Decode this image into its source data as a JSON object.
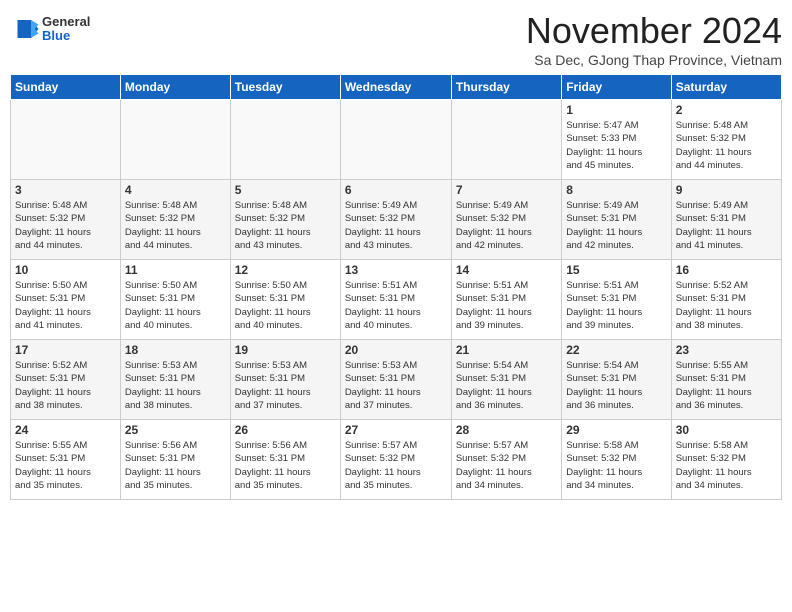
{
  "logo": {
    "general": "General",
    "blue": "Blue"
  },
  "title": "November 2024",
  "location": "Sa Dec, GJong Thap Province, Vietnam",
  "days_of_week": [
    "Sunday",
    "Monday",
    "Tuesday",
    "Wednesday",
    "Thursday",
    "Friday",
    "Saturday"
  ],
  "weeks": [
    [
      {
        "day": "",
        "info": ""
      },
      {
        "day": "",
        "info": ""
      },
      {
        "day": "",
        "info": ""
      },
      {
        "day": "",
        "info": ""
      },
      {
        "day": "",
        "info": ""
      },
      {
        "day": "1",
        "info": "Sunrise: 5:47 AM\nSunset: 5:33 PM\nDaylight: 11 hours\nand 45 minutes."
      },
      {
        "day": "2",
        "info": "Sunrise: 5:48 AM\nSunset: 5:32 PM\nDaylight: 11 hours\nand 44 minutes."
      }
    ],
    [
      {
        "day": "3",
        "info": "Sunrise: 5:48 AM\nSunset: 5:32 PM\nDaylight: 11 hours\nand 44 minutes."
      },
      {
        "day": "4",
        "info": "Sunrise: 5:48 AM\nSunset: 5:32 PM\nDaylight: 11 hours\nand 44 minutes."
      },
      {
        "day": "5",
        "info": "Sunrise: 5:48 AM\nSunset: 5:32 PM\nDaylight: 11 hours\nand 43 minutes."
      },
      {
        "day": "6",
        "info": "Sunrise: 5:49 AM\nSunset: 5:32 PM\nDaylight: 11 hours\nand 43 minutes."
      },
      {
        "day": "7",
        "info": "Sunrise: 5:49 AM\nSunset: 5:32 PM\nDaylight: 11 hours\nand 42 minutes."
      },
      {
        "day": "8",
        "info": "Sunrise: 5:49 AM\nSunset: 5:31 PM\nDaylight: 11 hours\nand 42 minutes."
      },
      {
        "day": "9",
        "info": "Sunrise: 5:49 AM\nSunset: 5:31 PM\nDaylight: 11 hours\nand 41 minutes."
      }
    ],
    [
      {
        "day": "10",
        "info": "Sunrise: 5:50 AM\nSunset: 5:31 PM\nDaylight: 11 hours\nand 41 minutes."
      },
      {
        "day": "11",
        "info": "Sunrise: 5:50 AM\nSunset: 5:31 PM\nDaylight: 11 hours\nand 40 minutes."
      },
      {
        "day": "12",
        "info": "Sunrise: 5:50 AM\nSunset: 5:31 PM\nDaylight: 11 hours\nand 40 minutes."
      },
      {
        "day": "13",
        "info": "Sunrise: 5:51 AM\nSunset: 5:31 PM\nDaylight: 11 hours\nand 40 minutes."
      },
      {
        "day": "14",
        "info": "Sunrise: 5:51 AM\nSunset: 5:31 PM\nDaylight: 11 hours\nand 39 minutes."
      },
      {
        "day": "15",
        "info": "Sunrise: 5:51 AM\nSunset: 5:31 PM\nDaylight: 11 hours\nand 39 minutes."
      },
      {
        "day": "16",
        "info": "Sunrise: 5:52 AM\nSunset: 5:31 PM\nDaylight: 11 hours\nand 38 minutes."
      }
    ],
    [
      {
        "day": "17",
        "info": "Sunrise: 5:52 AM\nSunset: 5:31 PM\nDaylight: 11 hours\nand 38 minutes."
      },
      {
        "day": "18",
        "info": "Sunrise: 5:53 AM\nSunset: 5:31 PM\nDaylight: 11 hours\nand 38 minutes."
      },
      {
        "day": "19",
        "info": "Sunrise: 5:53 AM\nSunset: 5:31 PM\nDaylight: 11 hours\nand 37 minutes."
      },
      {
        "day": "20",
        "info": "Sunrise: 5:53 AM\nSunset: 5:31 PM\nDaylight: 11 hours\nand 37 minutes."
      },
      {
        "day": "21",
        "info": "Sunrise: 5:54 AM\nSunset: 5:31 PM\nDaylight: 11 hours\nand 36 minutes."
      },
      {
        "day": "22",
        "info": "Sunrise: 5:54 AM\nSunset: 5:31 PM\nDaylight: 11 hours\nand 36 minutes."
      },
      {
        "day": "23",
        "info": "Sunrise: 5:55 AM\nSunset: 5:31 PM\nDaylight: 11 hours\nand 36 minutes."
      }
    ],
    [
      {
        "day": "24",
        "info": "Sunrise: 5:55 AM\nSunset: 5:31 PM\nDaylight: 11 hours\nand 35 minutes."
      },
      {
        "day": "25",
        "info": "Sunrise: 5:56 AM\nSunset: 5:31 PM\nDaylight: 11 hours\nand 35 minutes."
      },
      {
        "day": "26",
        "info": "Sunrise: 5:56 AM\nSunset: 5:31 PM\nDaylight: 11 hours\nand 35 minutes."
      },
      {
        "day": "27",
        "info": "Sunrise: 5:57 AM\nSunset: 5:32 PM\nDaylight: 11 hours\nand 35 minutes."
      },
      {
        "day": "28",
        "info": "Sunrise: 5:57 AM\nSunset: 5:32 PM\nDaylight: 11 hours\nand 34 minutes."
      },
      {
        "day": "29",
        "info": "Sunrise: 5:58 AM\nSunset: 5:32 PM\nDaylight: 11 hours\nand 34 minutes."
      },
      {
        "day": "30",
        "info": "Sunrise: 5:58 AM\nSunset: 5:32 PM\nDaylight: 11 hours\nand 34 minutes."
      }
    ]
  ]
}
